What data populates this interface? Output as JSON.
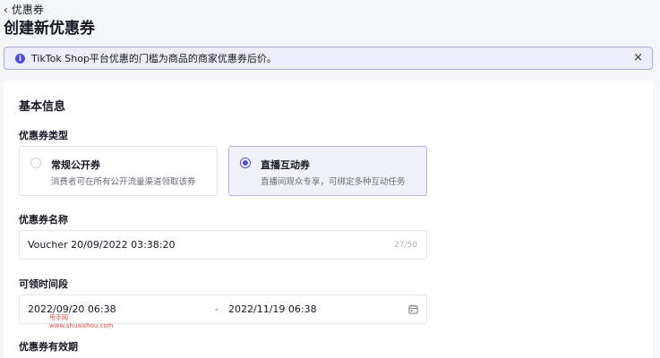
{
  "breadcrumb": {
    "label": "优惠券"
  },
  "page": {
    "title": "创建新优惠券"
  },
  "alert": {
    "text": "TikTok Shop平台优惠的门槛为商品的商家优惠券后价。"
  },
  "basic_info": {
    "title": "基本信息",
    "coupon_type": {
      "label": "优惠券类型",
      "options": [
        {
          "title": "常规公开券",
          "desc": "消费者可在所有公开流量渠道领取该券",
          "selected": false
        },
        {
          "title": "直播互动券",
          "desc": "直播间观众专享，可绑定多种互动任务",
          "selected": true
        }
      ]
    },
    "coupon_name": {
      "label": "优惠券名称",
      "value": "Voucher 20/09/2022 03:38:20",
      "counter": "27/50"
    },
    "claim_period": {
      "label": "可领时间段",
      "start": "2022/09/20 06:38",
      "separator": "-",
      "end": "2022/11/19 06:38"
    },
    "validity": {
      "label": "优惠券有效期"
    }
  },
  "watermark": {
    "line1": "甩手网",
    "line2": "www.shuaishou.com"
  },
  "colors": {
    "accent": "#4e4fd6",
    "alert_bg": "#eceefb"
  }
}
